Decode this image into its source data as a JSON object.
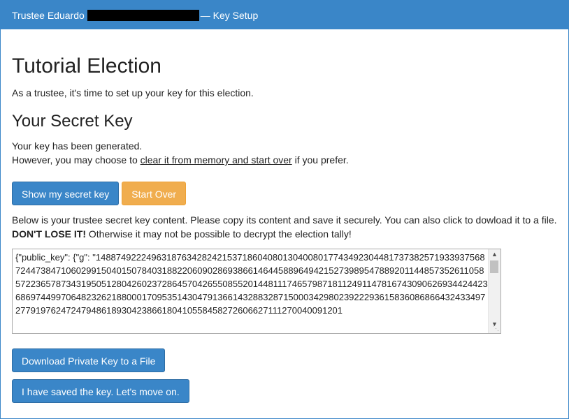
{
  "topbar": {
    "prefix": "Trustee Eduardo",
    "suffix": "— Key Setup"
  },
  "main": {
    "title": "Tutorial Election",
    "intro": "As a trustee, it's time to set up your key for this election.",
    "secret_title": "Your Secret Key",
    "generated_text": "Your key has been generated.",
    "choose_prefix": "However, you may choose to ",
    "choose_link": "clear it from memory and start over",
    "choose_suffix": " if you prefer.",
    "show_key_button": "Show my secret key",
    "start_over_button": "Start Over",
    "below_text": "Below is your trustee secret key content. Please copy its content and save it securely. You can also click to dowload it to a file.",
    "dont_lose_bold": "DON'T LOSE IT!",
    "dont_lose_rest": " Otherwise it may not be possible to decrypt the election tally!",
    "key_content": "{\"public_key\": {\"g\": \"14887492224963187634282421537186040801304008017743492304481737382571933937568724473847106029915040150784031882206090286938661464458896494215273989547889201144857352611058572236578734319505128042602372864570426550855201448111746579871811249114781674309062693442442368697449970648232621880001709535143047913661432883287150003429802392229361583608686643243349727791976247247948618930423866180410558458272606627111270040091201"
  },
  "buttons": {
    "download": "Download Private Key to a File",
    "saved": "I have saved the key. Let's move on."
  },
  "icons": {
    "scroll_up": "chevron-up-icon",
    "scroll_down": "chevron-down-icon",
    "resize": "resize-grip-icon"
  },
  "colors": {
    "primary": "#3a86c8",
    "warning": "#f0ad4e"
  }
}
